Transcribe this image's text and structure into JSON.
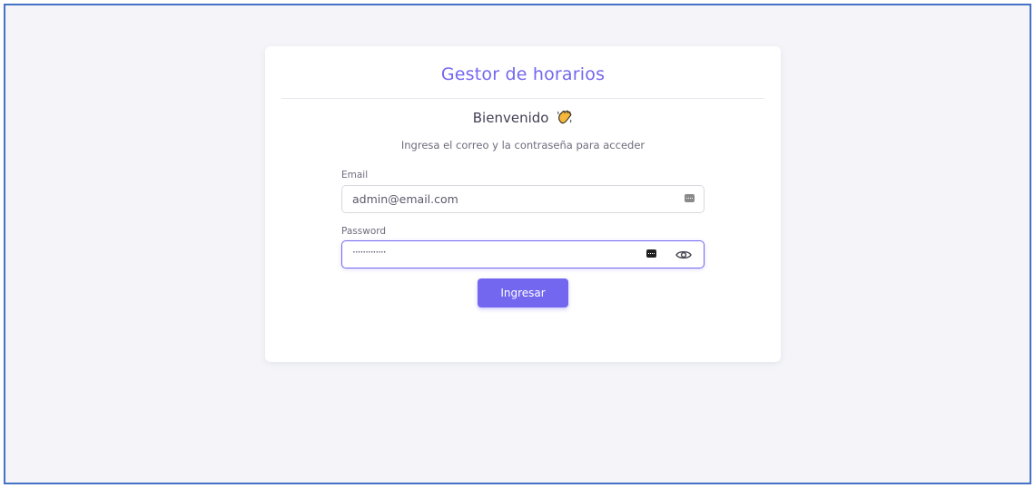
{
  "app": {
    "title": "Gestor de horarios"
  },
  "login": {
    "welcome": "Bienvenido",
    "subtitle": "Ingresa el correo y la contraseña para acceder",
    "email_label": "Email",
    "email_value": "admin@email.com",
    "password_label": "Password",
    "password_mask": "·············",
    "submit_label": "Ingresar"
  },
  "icons": {
    "welcome": "waving-hand-icon",
    "email_autofill": "autofill-key-icon",
    "password_autofill": "autofill-key-icon",
    "password_toggle": "eye-icon"
  },
  "colors": {
    "accent": "#7367f0",
    "page_background": "#f5f5f9",
    "card_background": "#ffffff",
    "frame_border": "#4472c4"
  }
}
